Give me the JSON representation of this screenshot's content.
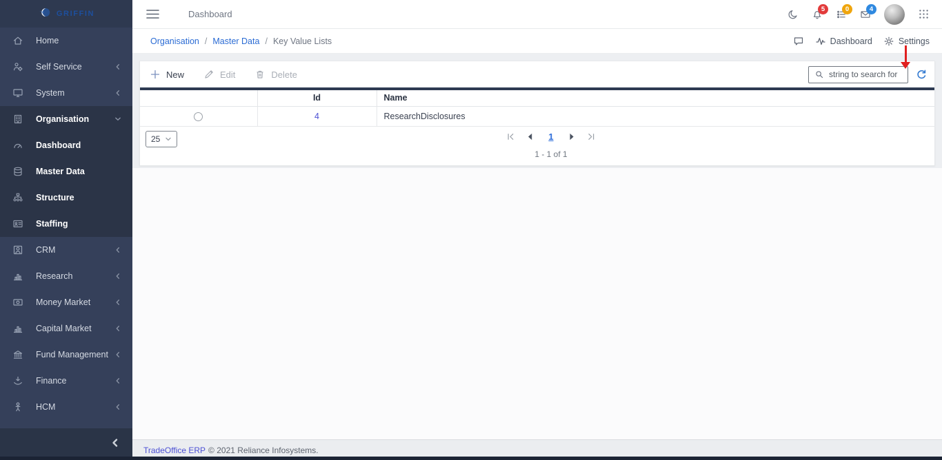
{
  "brand": {
    "name": "GRIFFIN"
  },
  "topbar": {
    "title": "Dashboard",
    "icons": [
      {
        "icon": "dark-mode-moon",
        "badge": null,
        "badge_color": null
      },
      {
        "icon": "notifications-bell",
        "badge": "5",
        "badge_color": "#e23b3b"
      },
      {
        "icon": "tasks-list",
        "badge": "0",
        "badge_color": "#efa50d"
      },
      {
        "icon": "messages-mail",
        "badge": "4",
        "badge_color": "#2f89e0"
      }
    ]
  },
  "sidebar": {
    "items": [
      {
        "label": "Home",
        "icon": "home",
        "chevron": null,
        "submenu": false
      },
      {
        "label": "Self Service",
        "icon": "self-service",
        "chevron": "left",
        "submenu": false
      },
      {
        "label": "System",
        "icon": "system",
        "chevron": "left",
        "submenu": false
      },
      {
        "label": "Organisation",
        "icon": "organisation",
        "chevron": "down",
        "submenu": true
      },
      {
        "label": "Dashboard",
        "icon": "dashboard",
        "chevron": null,
        "submenu": true
      },
      {
        "label": "Master Data",
        "icon": "master-data",
        "chevron": null,
        "submenu": true
      },
      {
        "label": "Structure",
        "icon": "structure",
        "chevron": null,
        "submenu": true
      },
      {
        "label": "Staffing",
        "icon": "staffing",
        "chevron": null,
        "submenu": true
      },
      {
        "label": "CRM",
        "icon": "crm",
        "chevron": "left",
        "submenu": false
      },
      {
        "label": "Research",
        "icon": "research",
        "chevron": "left",
        "submenu": false
      },
      {
        "label": "Money Market",
        "icon": "money-market",
        "chevron": "left",
        "submenu": false
      },
      {
        "label": "Capital Market",
        "icon": "capital-market",
        "chevron": "left",
        "submenu": false
      },
      {
        "label": "Fund Management",
        "icon": "fund-management",
        "chevron": "left",
        "submenu": false
      },
      {
        "label": "Finance",
        "icon": "finance",
        "chevron": "left",
        "submenu": false
      },
      {
        "label": "HCM",
        "icon": "hcm",
        "chevron": "left",
        "submenu": false
      }
    ]
  },
  "breadcrumb": {
    "items": [
      {
        "label": "Organisation",
        "link": true
      },
      {
        "label": "Master Data",
        "link": true
      },
      {
        "label": "Key Value Lists",
        "link": false
      }
    ]
  },
  "page_actions": {
    "dashboard": "Dashboard",
    "settings": "Settings"
  },
  "toolbar": {
    "new": "New",
    "edit": "Edit",
    "delete": "Delete",
    "search_placeholder": "string to search for"
  },
  "table": {
    "columns": [
      {
        "label": ""
      },
      {
        "label": "Id"
      },
      {
        "label": "Name"
      }
    ],
    "rows": [
      {
        "id": "4",
        "name": "ResearchDisclosures"
      }
    ]
  },
  "pagination": {
    "page_size": "25",
    "current_page": "1",
    "range": "1 - 1 of 1"
  },
  "footer": {
    "link": "TradeOffice ERP",
    "text": "© 2021 Reliance Infosystems."
  },
  "accents": {
    "link_blue": "#2a6bd4",
    "record_link": "#4c50d4",
    "badge_red": "#e23b3b",
    "badge_orange": "#efa50d",
    "badge_blue": "#2f89e0",
    "annotation_red": "#e01f1f",
    "sidebar_navy": "#35405a"
  }
}
